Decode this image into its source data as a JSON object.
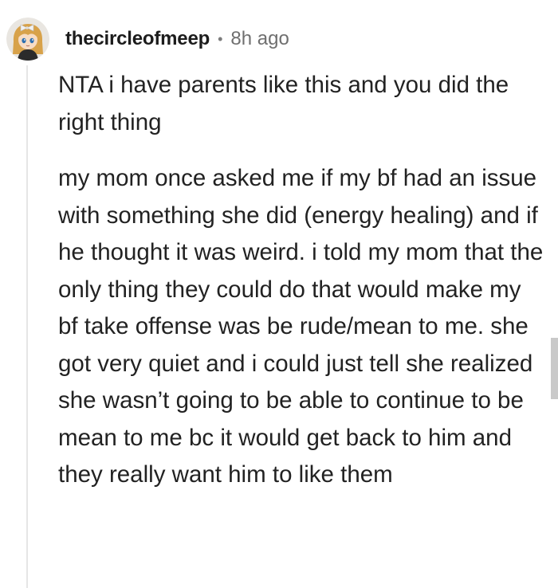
{
  "comment": {
    "username": "thecircleofmeep",
    "separator": "•",
    "timestamp": "8h ago",
    "paragraphs": [
      "NTA i have parents like this and you did the right thing",
      "my mom once asked me if my bf had an issue with something she did (energy healing) and if he thought it was weird. i told my mom that the only thing they could do that would make my bf take offense was be rude/mean to me. she got very quiet and i could just tell she realized she wasn’t going to be able to continue to be mean to me bc it would get back to him and they really want him to like them"
    ]
  },
  "avatar": {
    "icon": "cartoon-girl-avatar-icon",
    "colors": {
      "background": "#e9e6e1",
      "hair": "#d8a24a",
      "skin": "#f7dcc4",
      "eyes": "#2d6fb0",
      "dress": "#2b2b2b",
      "bow": "#f2f2f2"
    }
  },
  "colors": {
    "text": "#222222",
    "meta": "#6f6f6f",
    "thread_line": "#e6e6e6",
    "scrollbar": "#c9c9c9"
  }
}
